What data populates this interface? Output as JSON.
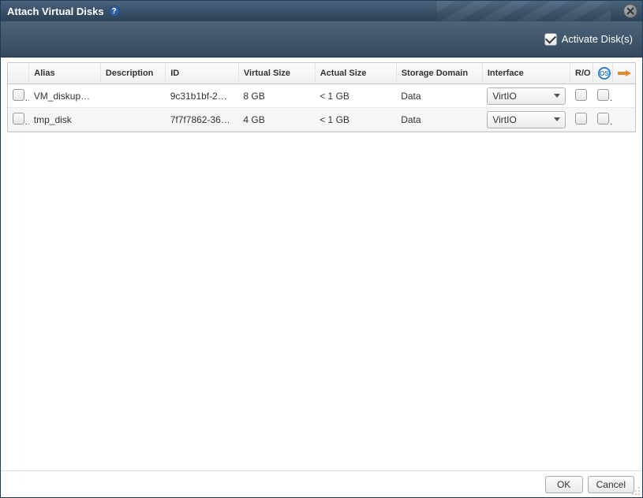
{
  "dialog": {
    "title": "Attach Virtual Disks",
    "activate_label": "Activate Disk(s)",
    "activate_checked": true
  },
  "columns": {
    "alias": "Alias",
    "description": "Description",
    "id": "ID",
    "virtual_size": "Virtual Size",
    "actual_size": "Actual Size",
    "storage_domain": "Storage Domain",
    "interface": "Interface",
    "ro": "R/O",
    "os": "OS",
    "boot": ""
  },
  "rows": [
    {
      "selected": false,
      "alias": "VM_diskup…",
      "description": "",
      "id": "9c31b1bf-2…",
      "virtual_size": "8 GB",
      "actual_size": "< 1 GB",
      "storage_domain": "Data",
      "interface": "VirtIO",
      "ro": false,
      "os": false
    },
    {
      "selected": false,
      "alias": "tmp_disk",
      "description": "",
      "id": "7f7f7862-36…",
      "virtual_size": "4 GB",
      "actual_size": "< 1 GB",
      "storage_domain": "Data",
      "interface": "VirtIO",
      "ro": false,
      "os": false
    }
  ],
  "buttons": {
    "ok": "OK",
    "cancel": "Cancel"
  }
}
